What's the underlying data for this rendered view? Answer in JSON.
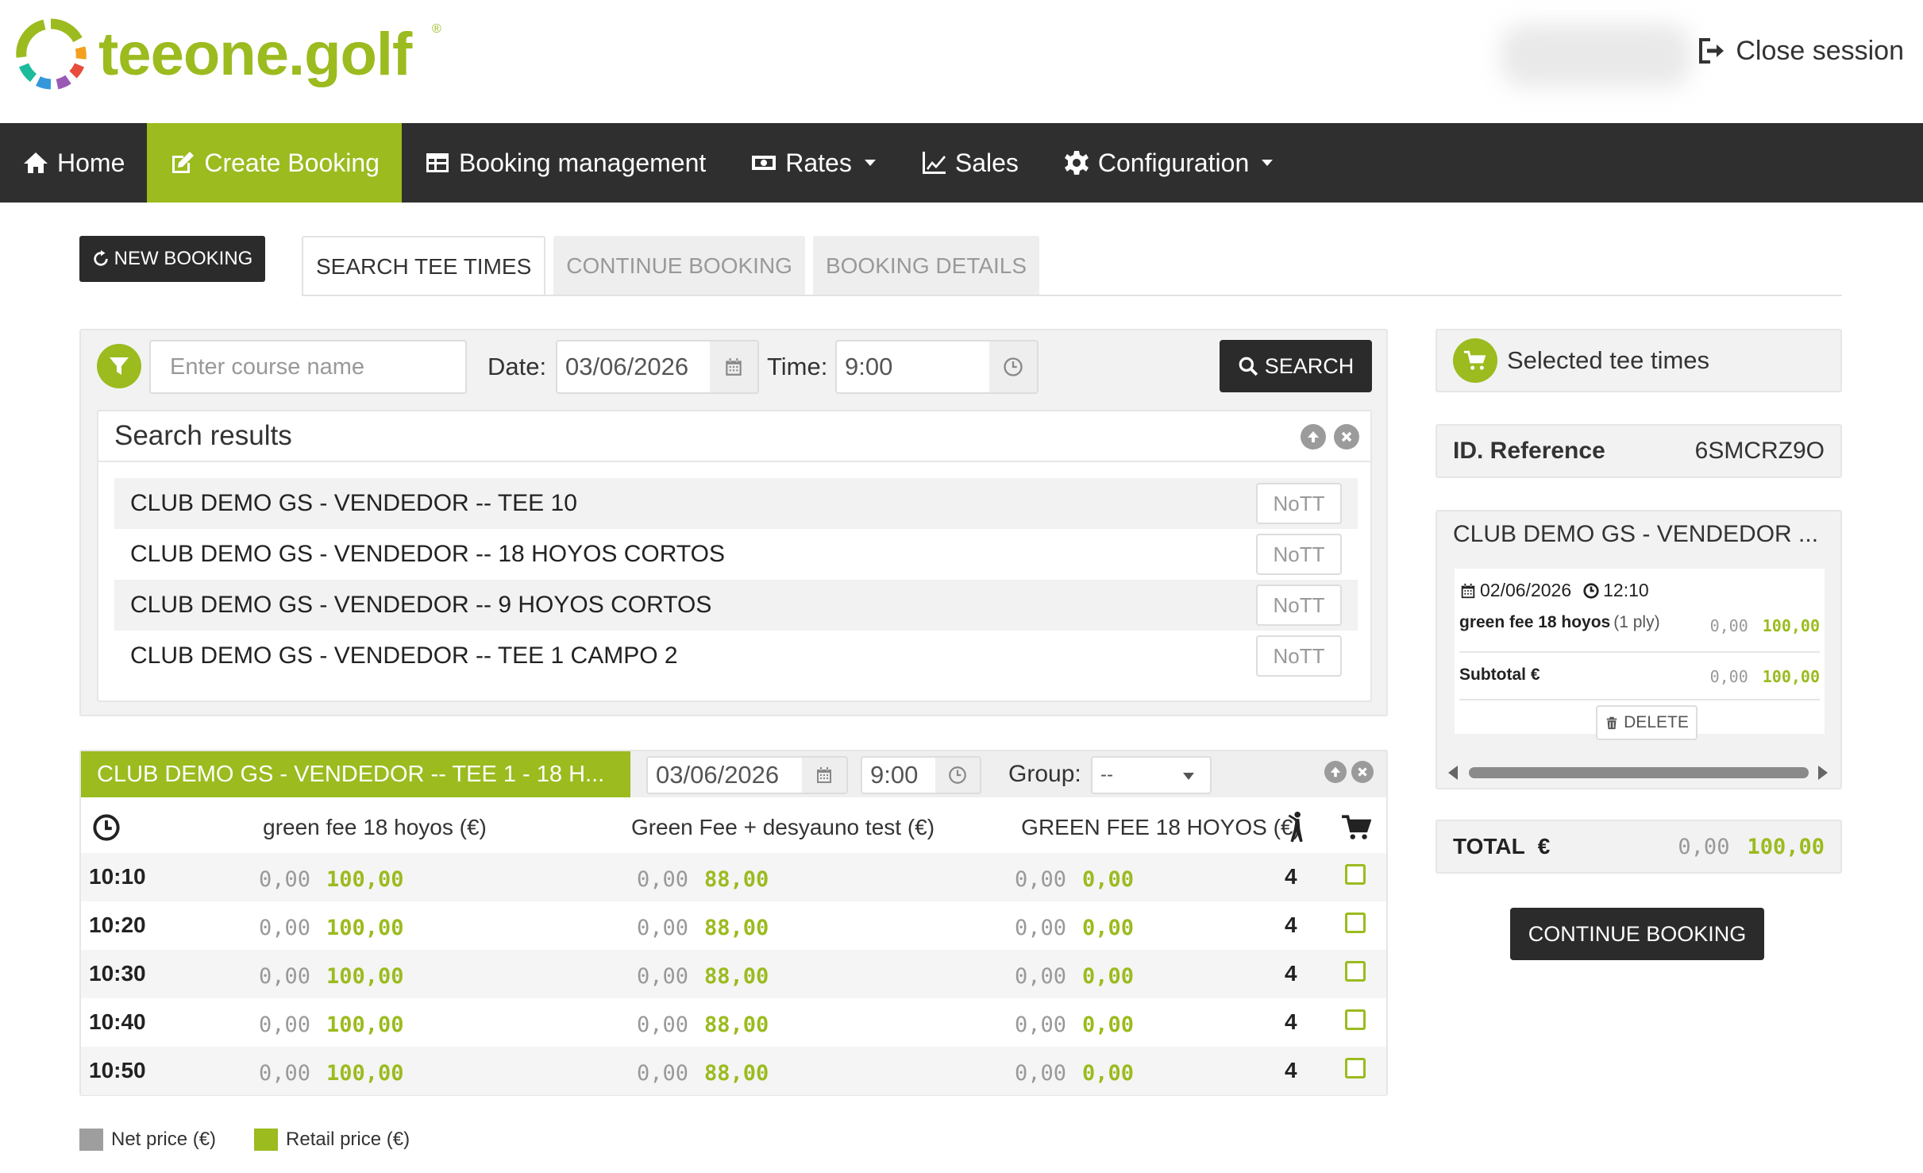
{
  "brand": {
    "name": "teeone.golf",
    "registered": "®",
    "accent": "#9bbb1f"
  },
  "header": {
    "close_session": "Close session"
  },
  "nav": [
    {
      "label": "Home",
      "icon": "home-icon"
    },
    {
      "label": "Create Booking",
      "icon": "edit-icon",
      "active": true
    },
    {
      "label": "Booking management",
      "icon": "table-icon"
    },
    {
      "label": "Rates",
      "icon": "money-icon",
      "dropdown": true
    },
    {
      "label": "Sales",
      "icon": "line-chart-icon"
    },
    {
      "label": "Configuration",
      "icon": "gear-icon",
      "dropdown": true
    }
  ],
  "toolbar": {
    "new_booking": "NEW BOOKING"
  },
  "tabs": [
    {
      "label": "SEARCH TEE TIMES",
      "active": true
    },
    {
      "label": "CONTINUE BOOKING"
    },
    {
      "label": "BOOKING DETAILS"
    }
  ],
  "search": {
    "course_placeholder": "Enter course name",
    "date_label": "Date:",
    "date_value": "03/06/2026",
    "time_label": "Time:",
    "time_value": "9:00",
    "button": "SEARCH"
  },
  "results": {
    "title": "Search results",
    "rows": [
      {
        "name": "CLUB DEMO GS - VENDEDOR -- TEE 10",
        "badge": "NoTT"
      },
      {
        "name": "CLUB DEMO GS - VENDEDOR -- 18 HOYOS CORTOS",
        "badge": "NoTT"
      },
      {
        "name": "CLUB DEMO GS - VENDEDOR -- 9 HOYOS CORTOS",
        "badge": "NoTT"
      },
      {
        "name": "CLUB DEMO GS - VENDEDOR -- TEE 1 CAMPO 2",
        "badge": "NoTT"
      }
    ]
  },
  "teetimes": {
    "title": "CLUB DEMO GS - VENDEDOR -- TEE 1 - 18 H...",
    "date": "03/06/2026",
    "time": "9:00",
    "group_label": "Group:",
    "group_value": "--",
    "columns": [
      "green fee 18 hoyos (€)",
      "Green Fee + desyauno test (€)",
      "GREEN FEE 18 HOYOS (€)"
    ],
    "rows": [
      {
        "time": "10:10",
        "prices": [
          [
            "0,00",
            "100,00"
          ],
          [
            "0,00",
            "88,00"
          ],
          [
            "0,00",
            "0,00"
          ]
        ],
        "players": "4"
      },
      {
        "time": "10:20",
        "prices": [
          [
            "0,00",
            "100,00"
          ],
          [
            "0,00",
            "88,00"
          ],
          [
            "0,00",
            "0,00"
          ]
        ],
        "players": "4"
      },
      {
        "time": "10:30",
        "prices": [
          [
            "0,00",
            "100,00"
          ],
          [
            "0,00",
            "88,00"
          ],
          [
            "0,00",
            "0,00"
          ]
        ],
        "players": "4"
      },
      {
        "time": "10:40",
        "prices": [
          [
            "0,00",
            "100,00"
          ],
          [
            "0,00",
            "88,00"
          ],
          [
            "0,00",
            "0,00"
          ]
        ],
        "players": "4"
      },
      {
        "time": "10:50",
        "prices": [
          [
            "0,00",
            "100,00"
          ],
          [
            "0,00",
            "88,00"
          ],
          [
            "0,00",
            "0,00"
          ]
        ],
        "players": "4"
      }
    ]
  },
  "legend": {
    "net": "Net price (€)",
    "retail": "Retail price (€)",
    "net_color": "#9e9e9e",
    "retail_color": "#9bbb1f"
  },
  "sidebar": {
    "selected_title": "Selected tee times",
    "id_label": "ID. Reference",
    "id_value": "6SMCRZ9O",
    "club": "CLUB DEMO GS - VENDEDOR ...",
    "item_date": "02/06/2026",
    "item_time": "12:10",
    "item_desc": "green fee 18 hoyos",
    "item_qty": "(1 ply)",
    "item_net": "0,00",
    "item_retail": "100,00",
    "subtotal_label": "Subtotal €",
    "subtotal_net": "0,00",
    "subtotal_retail": "100,00",
    "delete": "DELETE",
    "total_label": "TOTAL",
    "total_currency": "€",
    "total_net": "0,00",
    "total_retail": "100,00",
    "continue": "CONTINUE BOOKING"
  }
}
